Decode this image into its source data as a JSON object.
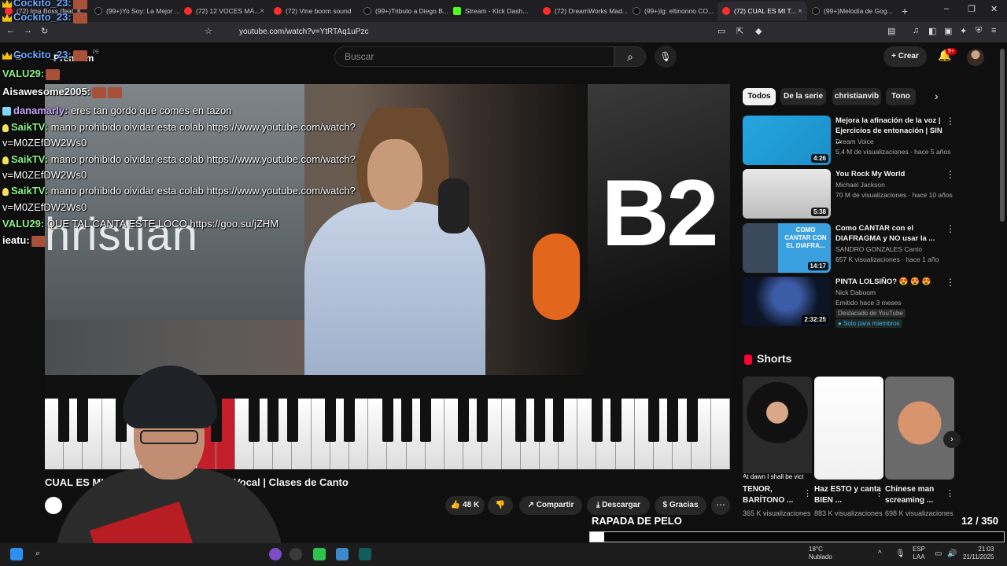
{
  "browser": {
    "tabs": [
      {
        "label": "(72) Ima Boss (feat. K...",
        "icon": "youtube-icon",
        "active": false
      },
      {
        "label": "(99+)Yo Soy: La Mejor ...",
        "icon": "tiktok-icon",
        "active": false
      },
      {
        "label": "(72) 12 VOCES MÁ...",
        "icon": "youtube-icon",
        "active": false
      },
      {
        "label": "(72) Vine boom sound",
        "icon": "youtube-icon",
        "active": false
      },
      {
        "label": "(99+)Tributo a Diego B...",
        "icon": "tiktok-icon",
        "active": false
      },
      {
        "label": "Stream - Kick Dash...",
        "icon": "kick-icon",
        "active": false
      },
      {
        "label": "(72) DreamWorks Mad...",
        "icon": "youtube-icon",
        "active": false
      },
      {
        "label": "(99+)lg: eltinonno CO...",
        "icon": "tiktok-icon",
        "active": false
      },
      {
        "label": "(72) CUAL ES MI T...",
        "icon": "youtube-icon",
        "active": true
      },
      {
        "label": "(99+)Melodía de Gog...",
        "icon": "tiktok-icon",
        "active": false
      }
    ],
    "url": "youtube.com/watch?v=YtRTAq1uPzc"
  },
  "youtube": {
    "logo_text": "Premium",
    "logo_region": "PE",
    "search_placeholder": "Buscar",
    "create_label": "Crear",
    "notifications_badge": "9+",
    "video_title": "CUAL ES MI ... en UN MINUTO | Rango Vocal | Clases de Canto",
    "video_overlay_text": "B2",
    "video_watermark": "hristian",
    "actions": {
      "likes": "48 K",
      "share": "Compartir",
      "download": "Descargar",
      "thanks": "Gracias"
    },
    "chips": [
      "Todos",
      "De la serie",
      "christianvib",
      "Tono"
    ],
    "recommendations": [
      {
        "title": "Mejora la afinación de la voz | Ejercicios de entonación | SIN ...",
        "channel": "Dream Voice",
        "meta": "5,4 M de visualizaciones · hace 5 años",
        "duration": "4:26"
      },
      {
        "title": "You Rock My World",
        "channel": "Michael Jackson",
        "meta": "70 M de visualizaciones · hace 10 años",
        "duration": "5:38"
      },
      {
        "title": "Como CANTAR con el DIAFRAGMA y NO usar la ...",
        "channel": "SANDRO GONZALES Canto",
        "meta": "657 K visualizaciones · hace 1 año",
        "duration": "14:17",
        "thumb_text": "COMO CANTAR CON EL DIAFRA..."
      },
      {
        "title": "PINTA LOLSIÑO? 😍 😍 😍",
        "channel": "Nick Daboom",
        "meta": "Emitido hace 3 meses",
        "duration": "2:32:25",
        "featured": "Destacado de YouTube",
        "members": "Solo para miembros"
      }
    ],
    "shorts_heading": "Shorts",
    "shorts": [
      {
        "title": "TENOR, BARÍTONO ...",
        "views": "365 K visualizaciones",
        "caption": "At dawn I shall be vict"
      },
      {
        "title": "Haz ESTO y canta BIEN ...",
        "views": "883 K visualizaciones"
      },
      {
        "title": "Chinese man screaming ...",
        "views": "698 K visualizaciones"
      }
    ]
  },
  "chat": [
    {
      "user": "Cockito_23:",
      "msg": "",
      "color": "blue",
      "badge": "crown"
    },
    {
      "user": "Cockito_23:",
      "msg": "",
      "color": "blue",
      "badge": "crown"
    },
    {
      "user": "Cockito_23:",
      "msg": "",
      "color": "blue",
      "badge": "crown"
    },
    {
      "user": "VALU29:",
      "msg": "",
      "color": "green",
      "badge": ""
    },
    {
      "user": "Aisawesome2005:",
      "msg": "",
      "color": "white",
      "badge": ""
    },
    {
      "user": "danamarly:",
      "msg": "eres tan gordo que comes en tazon",
      "color": "purple",
      "badge": "square"
    },
    {
      "user": "SaikTV:",
      "msg": "mano prohibido olvidar esta colab https://www.youtube.com/watch?",
      "color": "green",
      "badge": "bulb"
    },
    {
      "user": "",
      "msg": "v=M0ZEfDW2Ws0",
      "color": "white",
      "badge": ""
    },
    {
      "user": "SaikTV:",
      "msg": "mano prohibido olvidar esta colab https://www.youtube.com/watch?",
      "color": "green",
      "badge": "bulb"
    },
    {
      "user": "",
      "msg": "v=M0ZEfDW2Ws0",
      "color": "white",
      "badge": ""
    },
    {
      "user": "SaikTV:",
      "msg": "mano prohibido olvidar esta colab https://www.youtube.com/watch?",
      "color": "green",
      "badge": "bulb"
    },
    {
      "user": "",
      "msg": "v=M0ZEfDW2Ws0",
      "color": "white",
      "badge": ""
    },
    {
      "user": "VALU29:",
      "msg": "QUE TAL CANTA ESTE LOCO https://goo.su/jZHM",
      "color": "green",
      "badge": ""
    },
    {
      "user": "ieatu:",
      "msg": "",
      "color": "white",
      "badge": ""
    }
  ],
  "stream_overlay": {
    "label": "RAPADA DE PELO",
    "counter": "12 / 350",
    "progress_fraction": 0.034
  },
  "taskbar": {
    "weather_temp": "18°C",
    "weather_desc": "Nublado",
    "lang_1": "ESP",
    "lang_2": "LAA",
    "time": "21:03",
    "date": "21/11/2025"
  },
  "colors": {
    "youtube_red": "#ff0033",
    "chat_blue": "#6ea7ff",
    "chat_green": "#8cf08c",
    "chat_purple": "#c6a4ff"
  }
}
